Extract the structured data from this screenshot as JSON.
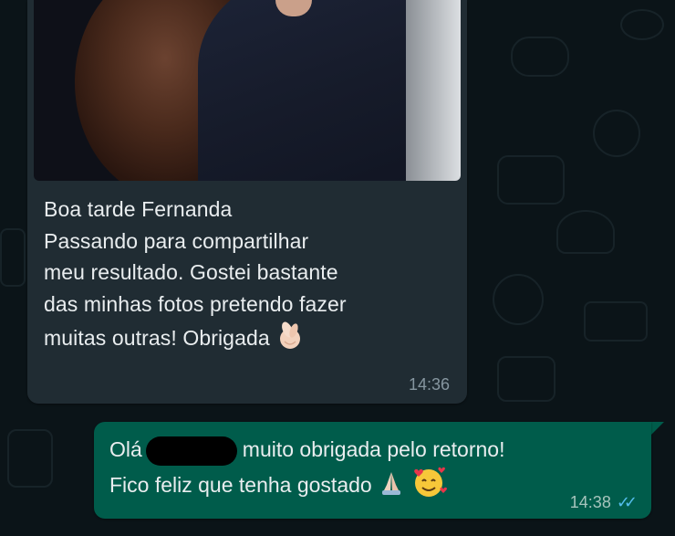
{
  "incoming": {
    "lines": [
      "Boa tarde Fernanda",
      "Passando para compartilhar",
      "meu resultado. Gostei bastante",
      "das minhas fotos pretendo fazer",
      "muitas outras! Obrigada"
    ],
    "emoji": "finger-heart-icon",
    "time": "14:36"
  },
  "outgoing": {
    "line1_prefix": "Olá",
    "line1_suffix": "muito obrigada pelo retorno!",
    "line2": "Fico feliz que tenha gostado",
    "emojis": [
      "folded-hands-icon",
      "smiling-face-with-hearts-icon"
    ],
    "time": "14:38",
    "status": "read-double-check-icon"
  },
  "colors": {
    "incoming_bubble": "#202c33",
    "outgoing_bubble": "#005c4b",
    "read_ticks": "#53bdeb",
    "background": "#0b1418"
  }
}
